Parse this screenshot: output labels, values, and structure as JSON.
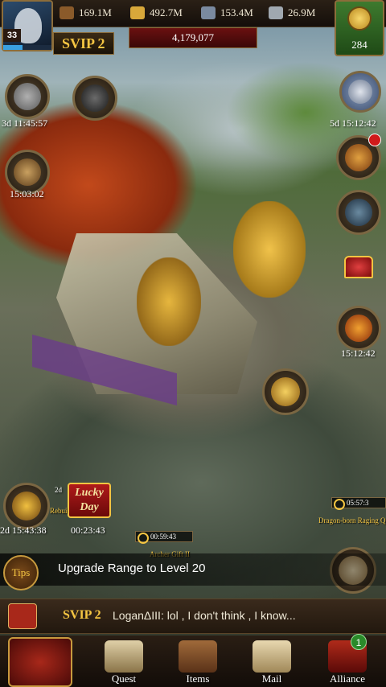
{
  "resources": [
    {
      "name": "wood",
      "icon": "wood-icon",
      "value": "169.1M"
    },
    {
      "name": "food",
      "icon": "wheat-icon",
      "value": "492.7M"
    },
    {
      "name": "stone",
      "icon": "stone-icon",
      "value": "153.4M"
    },
    {
      "name": "ore",
      "icon": "ore-icon",
      "value": "26.9M"
    }
  ],
  "player": {
    "level": "33",
    "xp_fraction": 0.4,
    "svip": "SVIP 2",
    "power": "4,179,077"
  },
  "gold": {
    "amount": "284"
  },
  "left_timers": {
    "hammer1": "3d 11:45:57",
    "hammer2": "15:03:02",
    "hero": "2d 15:43:38"
  },
  "right_timers": {
    "event": "5d 15:12:42",
    "chest": "15:12:42"
  },
  "map": {
    "lucky_day": "Lucky Day",
    "lucky_timer": "00:23:43",
    "lucky_mini_timer": "2d",
    "build_timer_1": "00:59:43",
    "build_label_1": "Archer Gift II",
    "build_timer_2": "05:57:3",
    "build_label_2": "Dragon-born Raging Q",
    "build_label_3": "Rebui"
  },
  "tips": {
    "badge": "Tips",
    "text": "Upgrade Range to Level 20"
  },
  "chat": {
    "svip": "SVIP 2",
    "message": "LoganΔIII: lol , I don't think , I know..."
  },
  "nav": {
    "quest": "Quest",
    "items": "Items",
    "mail": "Mail",
    "alliance": "Alliance",
    "alliance_badge": "1"
  },
  "colors": {
    "accent_gold": "#f4c542",
    "power_red": "#6a1010",
    "gold_button_green": "#3e7a2e"
  }
}
